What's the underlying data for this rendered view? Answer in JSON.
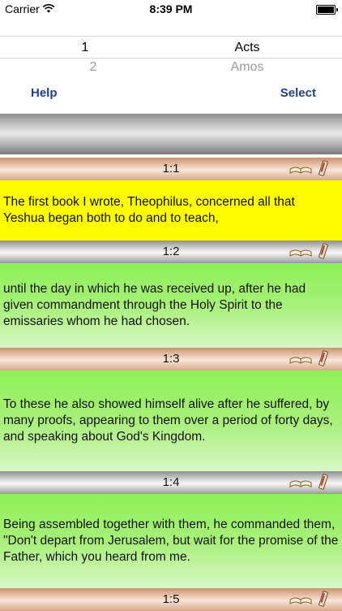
{
  "status_bar": {
    "carrier": "Carrier",
    "time": "8:39 PM"
  },
  "picker": {
    "selected_number": "1",
    "selected_book": "Acts",
    "next_number": "2",
    "next_book": "Amos"
  },
  "toolbar": {
    "help_label": "Help",
    "select_label": "Select"
  },
  "verses": [
    {
      "ref": "1:1",
      "text": "The first book I wrote, Theophilus, concerned all that Yeshua began both to do and to teach,"
    },
    {
      "ref": "1:2",
      "text": "until the day in which he was received up, after he had given commandment through the Holy Spirit to the emissaries whom he had chosen."
    },
    {
      "ref": "1:3",
      "text": "To these he also showed himself alive after he suffered, by many proofs, appearing to them over a period of forty days, and speaking about God's Kingdom."
    },
    {
      "ref": "1:4",
      "text": "Being assembled together with them, he commanded them, \"Don't depart from Jerusalem, but wait for the promise of the Father, which you heard from me."
    },
    {
      "ref": "1:5",
      "text": ""
    }
  ],
  "colors": {
    "link_blue": "#1f3f8c",
    "highlight_yellow": "#fdfd00",
    "verse_green": "#8ef059"
  }
}
